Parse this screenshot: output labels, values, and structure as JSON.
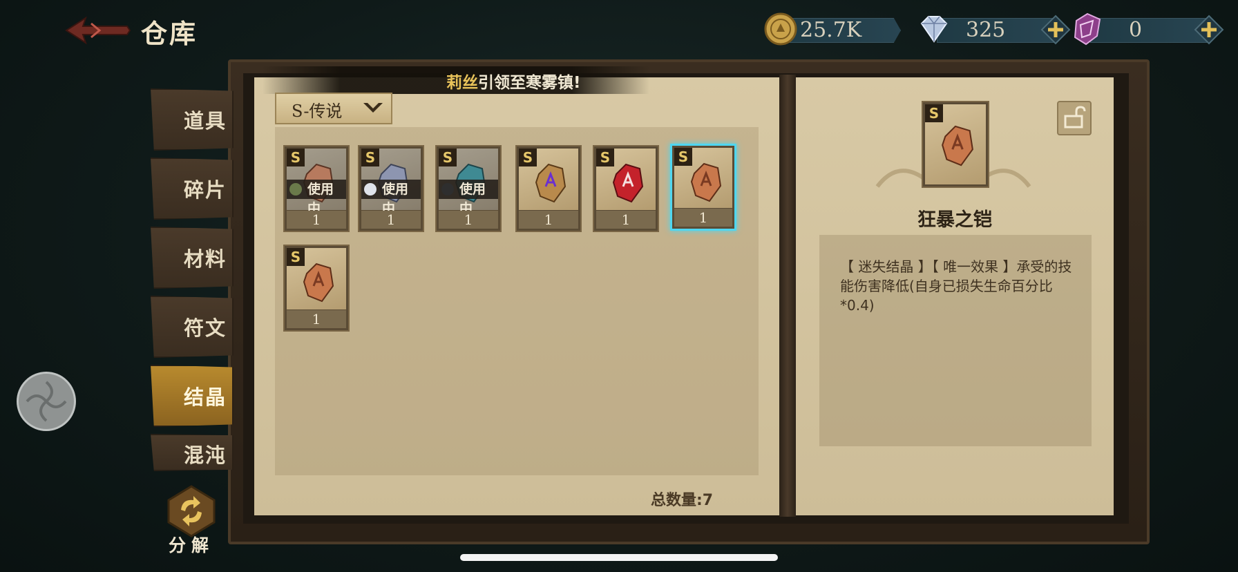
{
  "header": {
    "title": "仓库",
    "back_icon": "back-arrow-icon"
  },
  "currencies": [
    {
      "name": "coin",
      "icon": "gold-coin-icon",
      "value": "25.7K",
      "has_plus": false
    },
    {
      "name": "diamond",
      "icon": "diamond-icon",
      "value": "325",
      "has_plus": true
    },
    {
      "name": "gem",
      "icon": "purple-crystal-icon",
      "value": "0",
      "has_plus": true
    }
  ],
  "sidebar": {
    "tabs": [
      {
        "label": "道具",
        "active": false
      },
      {
        "label": "碎片",
        "active": false
      },
      {
        "label": "材料",
        "active": false
      },
      {
        "label": "符文",
        "active": false
      },
      {
        "label": "结晶",
        "active": true
      },
      {
        "label": "混沌",
        "active": false
      }
    ]
  },
  "banner": {
    "highlight": "莉丝",
    "text": "引领至寒雾镇!"
  },
  "filter": {
    "selected": "S-传说"
  },
  "inventory": {
    "items": [
      {
        "badge": "S",
        "count": "1",
        "in_use": true,
        "in_use_label": "使用中",
        "gem_color": "#b77a5e",
        "selected": false
      },
      {
        "badge": "S",
        "count": "1",
        "in_use": true,
        "in_use_label": "使用中",
        "gem_color": "#8d95b0",
        "selected": false
      },
      {
        "badge": "S",
        "count": "1",
        "in_use": true,
        "in_use_label": "使用中",
        "gem_color": "#3f8a93",
        "selected": false
      },
      {
        "badge": "S",
        "count": "1",
        "in_use": false,
        "in_use_label": "",
        "gem_color": "#b98a4c",
        "selected": false
      },
      {
        "badge": "S",
        "count": "1",
        "in_use": false,
        "in_use_label": "",
        "gem_color": "#c4222b",
        "selected": false
      },
      {
        "badge": "S",
        "count": "1",
        "in_use": false,
        "in_use_label": "",
        "gem_color": "#c9784c",
        "selected": true
      },
      {
        "badge": "S",
        "count": "1",
        "in_use": false,
        "in_use_label": "",
        "gem_color": "#c9784c",
        "selected": false
      }
    ],
    "total_label": "总数量:7"
  },
  "detail": {
    "badge": "S",
    "name": "狂暴之铠",
    "description": "【 迷失结晶 】【 唯一效果 】承受的技能伤害降低(自身已损失生命百分比*0.4)",
    "lock_icon": "unlock-icon"
  },
  "bottom": {
    "decompose_label": "分解",
    "decompose_icon": "recycle-icon"
  },
  "colors": {
    "accent": "#4fd6f0",
    "active_tab": "#b88a2e",
    "parchment": "#d8c9a5"
  }
}
